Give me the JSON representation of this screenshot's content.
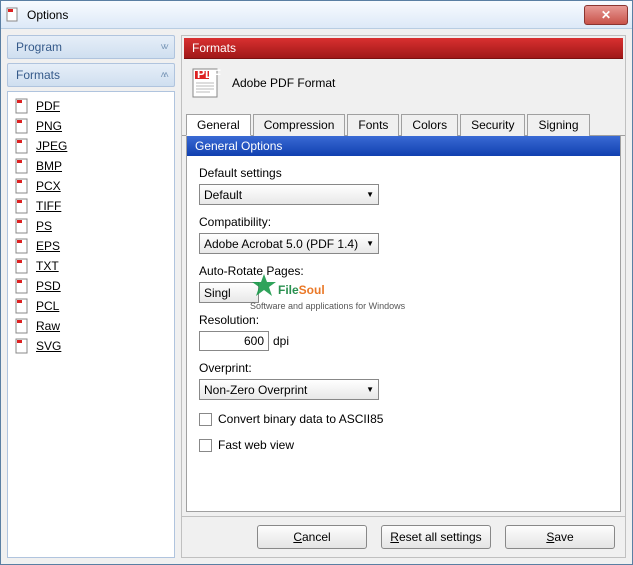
{
  "window": {
    "title": "Options"
  },
  "sidebar": {
    "program_label": "Program",
    "formats_label": "Formats",
    "items": [
      {
        "label": "PDF"
      },
      {
        "label": "PNG"
      },
      {
        "label": "JPEG"
      },
      {
        "label": "BMP"
      },
      {
        "label": "PCX"
      },
      {
        "label": "TIFF"
      },
      {
        "label": "PS"
      },
      {
        "label": "EPS"
      },
      {
        "label": "TXT"
      },
      {
        "label": "PSD"
      },
      {
        "label": "PCL"
      },
      {
        "label": "Raw"
      },
      {
        "label": "SVG"
      }
    ]
  },
  "main": {
    "formats_header": "Formats",
    "format_name": "Adobe PDF Format",
    "tabs": [
      "General",
      "Compression",
      "Fonts",
      "Colors",
      "Security",
      "Signing"
    ],
    "section_title": "General Options",
    "fields": {
      "default_label": "Default settings",
      "default_value": "Default",
      "compat_label": "Compatibility:",
      "compat_value": "Adobe Acrobat 5.0 (PDF 1.4)",
      "autorotate_label": "Auto-Rotate Pages:",
      "autorotate_value": "Singl",
      "resolution_label": "Resolution:",
      "resolution_value": "600",
      "resolution_unit": "dpi",
      "overprint_label": "Overprint:",
      "overprint_value": "Non-Zero Overprint",
      "cb_ascii": "Convert binary data to ASCII85",
      "cb_fastweb": "Fast web view"
    }
  },
  "buttons": {
    "cancel": "Cancel",
    "reset": "Reset all settings",
    "save": "Save"
  },
  "watermark": {
    "brand1": "File",
    "brand2": "Soul",
    "tagline": "Software and applications for Windows"
  }
}
